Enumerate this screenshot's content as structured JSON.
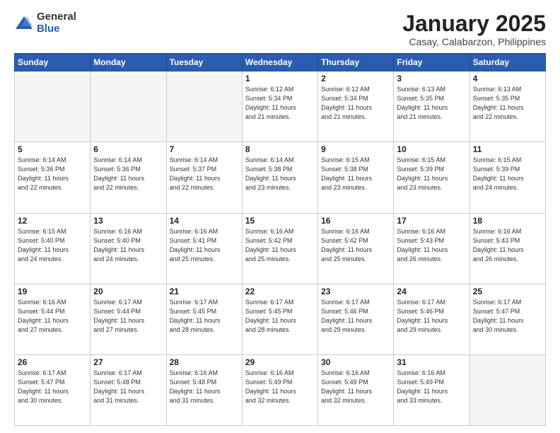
{
  "logo": {
    "general": "General",
    "blue": "Blue"
  },
  "title": {
    "month": "January 2025",
    "location": "Casay, Calabarzon, Philippines"
  },
  "days_header": [
    "Sunday",
    "Monday",
    "Tuesday",
    "Wednesday",
    "Thursday",
    "Friday",
    "Saturday"
  ],
  "weeks": [
    [
      {
        "day": "",
        "info": ""
      },
      {
        "day": "",
        "info": ""
      },
      {
        "day": "",
        "info": ""
      },
      {
        "day": "1",
        "info": "Sunrise: 6:12 AM\nSunset: 5:34 PM\nDaylight: 11 hours\nand 21 minutes."
      },
      {
        "day": "2",
        "info": "Sunrise: 6:12 AM\nSunset: 5:34 PM\nDaylight: 11 hours\nand 21 minutes."
      },
      {
        "day": "3",
        "info": "Sunrise: 6:13 AM\nSunset: 5:35 PM\nDaylight: 11 hours\nand 21 minutes."
      },
      {
        "day": "4",
        "info": "Sunrise: 6:13 AM\nSunset: 5:35 PM\nDaylight: 11 hours\nand 22 minutes."
      }
    ],
    [
      {
        "day": "5",
        "info": "Sunrise: 6:14 AM\nSunset: 5:36 PM\nDaylight: 11 hours\nand 22 minutes."
      },
      {
        "day": "6",
        "info": "Sunrise: 6:14 AM\nSunset: 5:36 PM\nDaylight: 11 hours\nand 22 minutes."
      },
      {
        "day": "7",
        "info": "Sunrise: 6:14 AM\nSunset: 5:37 PM\nDaylight: 11 hours\nand 22 minutes."
      },
      {
        "day": "8",
        "info": "Sunrise: 6:14 AM\nSunset: 5:38 PM\nDaylight: 11 hours\nand 23 minutes."
      },
      {
        "day": "9",
        "info": "Sunrise: 6:15 AM\nSunset: 5:38 PM\nDaylight: 11 hours\nand 23 minutes."
      },
      {
        "day": "10",
        "info": "Sunrise: 6:15 AM\nSunset: 5:39 PM\nDaylight: 11 hours\nand 23 minutes."
      },
      {
        "day": "11",
        "info": "Sunrise: 6:15 AM\nSunset: 5:39 PM\nDaylight: 11 hours\nand 24 minutes."
      }
    ],
    [
      {
        "day": "12",
        "info": "Sunrise: 6:15 AM\nSunset: 5:40 PM\nDaylight: 11 hours\nand 24 minutes."
      },
      {
        "day": "13",
        "info": "Sunrise: 6:16 AM\nSunset: 5:40 PM\nDaylight: 11 hours\nand 24 minutes."
      },
      {
        "day": "14",
        "info": "Sunrise: 6:16 AM\nSunset: 5:41 PM\nDaylight: 11 hours\nand 25 minutes."
      },
      {
        "day": "15",
        "info": "Sunrise: 6:16 AM\nSunset: 5:42 PM\nDaylight: 11 hours\nand 25 minutes."
      },
      {
        "day": "16",
        "info": "Sunrise: 6:16 AM\nSunset: 5:42 PM\nDaylight: 11 hours\nand 25 minutes."
      },
      {
        "day": "17",
        "info": "Sunrise: 6:16 AM\nSunset: 5:43 PM\nDaylight: 11 hours\nand 26 minutes."
      },
      {
        "day": "18",
        "info": "Sunrise: 6:16 AM\nSunset: 5:43 PM\nDaylight: 11 hours\nand 26 minutes."
      }
    ],
    [
      {
        "day": "19",
        "info": "Sunrise: 6:16 AM\nSunset: 5:44 PM\nDaylight: 11 hours\nand 27 minutes."
      },
      {
        "day": "20",
        "info": "Sunrise: 6:17 AM\nSunset: 5:44 PM\nDaylight: 11 hours\nand 27 minutes."
      },
      {
        "day": "21",
        "info": "Sunrise: 6:17 AM\nSunset: 5:45 PM\nDaylight: 11 hours\nand 28 minutes."
      },
      {
        "day": "22",
        "info": "Sunrise: 6:17 AM\nSunset: 5:45 PM\nDaylight: 11 hours\nand 28 minutes."
      },
      {
        "day": "23",
        "info": "Sunrise: 6:17 AM\nSunset: 5:46 PM\nDaylight: 11 hours\nand 29 minutes."
      },
      {
        "day": "24",
        "info": "Sunrise: 6:17 AM\nSunset: 5:46 PM\nDaylight: 11 hours\nand 29 minutes."
      },
      {
        "day": "25",
        "info": "Sunrise: 6:17 AM\nSunset: 5:47 PM\nDaylight: 11 hours\nand 30 minutes."
      }
    ],
    [
      {
        "day": "26",
        "info": "Sunrise: 6:17 AM\nSunset: 5:47 PM\nDaylight: 11 hours\nand 30 minutes."
      },
      {
        "day": "27",
        "info": "Sunrise: 6:17 AM\nSunset: 5:48 PM\nDaylight: 11 hours\nand 31 minutes."
      },
      {
        "day": "28",
        "info": "Sunrise: 6:16 AM\nSunset: 5:48 PM\nDaylight: 11 hours\nand 31 minutes."
      },
      {
        "day": "29",
        "info": "Sunrise: 6:16 AM\nSunset: 5:49 PM\nDaylight: 11 hours\nand 32 minutes."
      },
      {
        "day": "30",
        "info": "Sunrise: 6:16 AM\nSunset: 5:49 PM\nDaylight: 11 hours\nand 32 minutes."
      },
      {
        "day": "31",
        "info": "Sunrise: 6:16 AM\nSunset: 5:49 PM\nDaylight: 11 hours\nand 33 minutes."
      },
      {
        "day": "",
        "info": ""
      }
    ]
  ]
}
